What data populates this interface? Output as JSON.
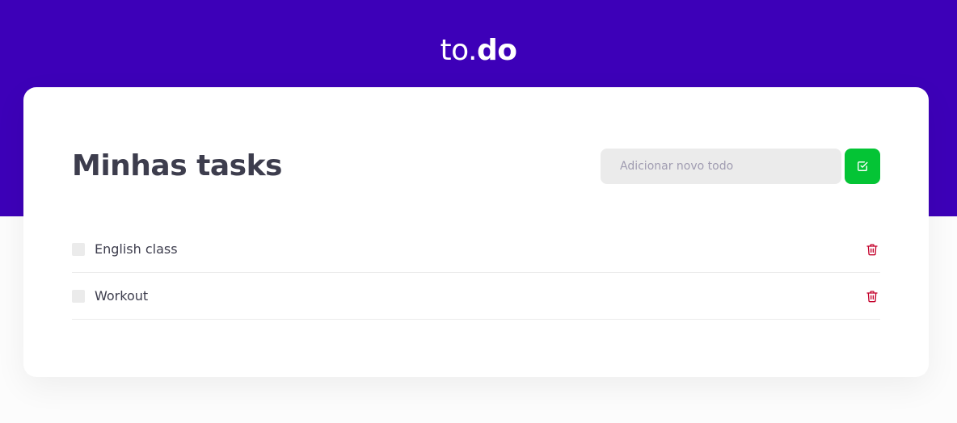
{
  "app": {
    "logo_light": "to.",
    "logo_bold": "do"
  },
  "main": {
    "title": "Minhas tasks",
    "add": {
      "placeholder": "Adicionar novo todo",
      "value": "",
      "button_icon": "check-square-icon"
    },
    "tasks": [
      {
        "label": "English class",
        "done": false,
        "delete_icon": "trash-icon"
      },
      {
        "label": "Workout",
        "done": false,
        "delete_icon": "trash-icon"
      }
    ]
  },
  "colors": {
    "header": "#3d00b8",
    "accent_green": "#04c435",
    "delete_red": "#e83f5b",
    "text_dark": "#3d3d4d"
  }
}
